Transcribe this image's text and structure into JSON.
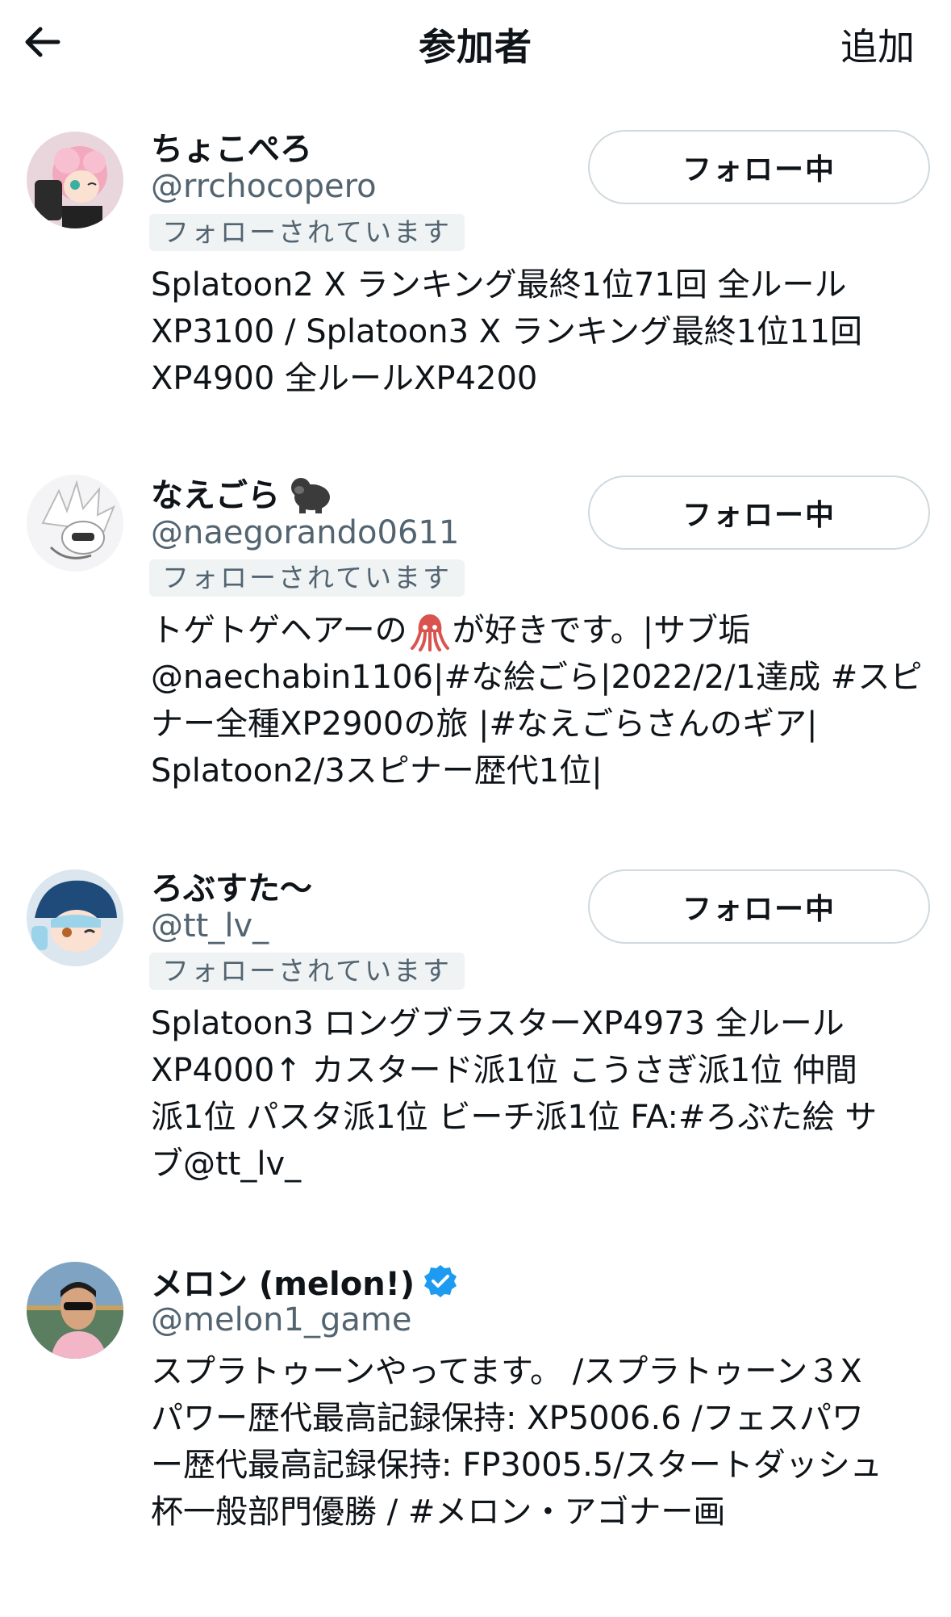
{
  "header": {
    "back_icon": "arrow-left-icon",
    "title": "参加者",
    "add_label": "追加"
  },
  "users": [
    {
      "name": "ちょこぺろ",
      "handle": "@rrchocopero",
      "follows_you": "フォローされています",
      "bio": "Splatoon2 X ランキング最終1位71回 全ルール\nXP3100 / Splatoon3 X ランキング最終1位11回\nXP4900 全ルールXP4200",
      "button": "フォロー中"
    },
    {
      "name": "なえごら",
      "name_emoji": "gorilla-emoji",
      "handle": "@naegorando0611",
      "follows_you": "フォローされています",
      "bio_part1": "トゲトゲヘアーの",
      "bio_emoji": "squid-emoji",
      "bio_part2": "が好きです。|サブ垢\n@naechabin1106|#な絵ごら|2022/2/1達成 #スピ\nナー全種XP2900の旅 |#なえごらさんのギア|\nSplatoon2/3スピナー歴代1位|",
      "button": "フォロー中"
    },
    {
      "name": "ろぶすた〜",
      "handle": "@tt_lv_",
      "follows_you": "フォローされています",
      "bio": "Splatoon3 ロングブラスターXP4973 全ルール\nXP4000↑ カスタード派1位 こうさぎ派1位 仲間\n派1位 パスタ派1位 ビーチ派1位 FA:#ろぶた絵 サ\nブ@tt_lv_",
      "button": "フォロー中"
    },
    {
      "name": "メロン (melon!)",
      "verified_icon": "verified-badge-icon",
      "handle": "@melon1_game",
      "bio": "スプラトゥーンやってます。 /スプラトゥーン３X\nパワー歴代最高記録保持: XP5006.6 /フェスパワ\nー歴代最高記録保持: FP3005.5/スタートダッシュ\n杯一般部門優勝 / #メロン・アゴナー画"
    }
  ],
  "colors": {
    "text_primary": "#0f1419",
    "text_secondary": "#536471",
    "badge_bg": "#eff3f4",
    "button_border": "#cfd9de",
    "verified_blue": "#1d9bf0"
  }
}
